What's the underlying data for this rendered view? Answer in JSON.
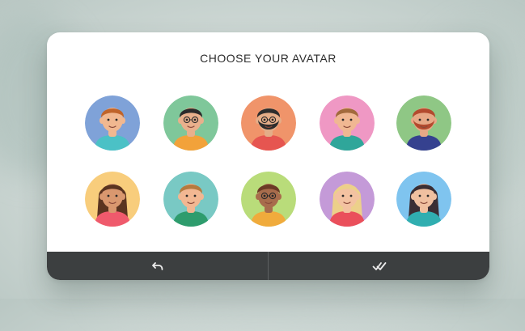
{
  "dialog": {
    "title": "CHOOSE YOUR AVATAR",
    "footer": {
      "undo_icon": "undo-arrow-icon",
      "confirm_icon": "checkmark-icon"
    }
  },
  "avatars": [
    {
      "bg": "#7fa2d8",
      "skin": "#f1b890",
      "hair": "#c0642a",
      "shirt": "#4bc1c6",
      "glasses": false,
      "beard": null,
      "long_hair": false
    },
    {
      "bg": "#7fc79a",
      "skin": "#e8b08c",
      "hair": "#2b2b2b",
      "shirt": "#f2a23a",
      "glasses": true,
      "beard": null,
      "long_hair": false
    },
    {
      "bg": "#f0946a",
      "skin": "#e4ad88",
      "hair": "#2d2d2d",
      "shirt": "#e65550",
      "glasses": true,
      "beard": "#2d2d2d",
      "long_hair": false
    },
    {
      "bg": "#ef98c4",
      "skin": "#f0b792",
      "hair": "#a26a3c",
      "shirt": "#2fa69a",
      "glasses": false,
      "beard": null,
      "long_hair": false
    },
    {
      "bg": "#8fc785",
      "skin": "#e7a886",
      "hair": "#b34a2e",
      "shirt": "#35418f",
      "glasses": false,
      "beard": "#b34a2e",
      "long_hair": false
    },
    {
      "bg": "#f8cd7c",
      "skin": "#d9986f",
      "hair": "#5a3420",
      "shirt": "#ef5a6c",
      "glasses": false,
      "beard": null,
      "long_hair": true
    },
    {
      "bg": "#79c9c4",
      "skin": "#f2b792",
      "hair": "#b57a3e",
      "shirt": "#2e9c6d",
      "glasses": false,
      "beard": null,
      "long_hair": false
    },
    {
      "bg": "#b9dc7a",
      "skin": "#a86c4c",
      "hair": "#6b3a26",
      "shirt": "#f0ab3c",
      "glasses": true,
      "beard": null,
      "long_hair": false
    },
    {
      "bg": "#c49ad8",
      "skin": "#f3c2a1",
      "hair": "#ecd08a",
      "shirt": "#ea4f5b",
      "glasses": false,
      "beard": null,
      "long_hair": true
    },
    {
      "bg": "#7fc4ef",
      "skin": "#f0c0a0",
      "hair": "#3a2e34",
      "shirt": "#30aeb0",
      "glasses": false,
      "beard": null,
      "long_hair": true
    }
  ]
}
